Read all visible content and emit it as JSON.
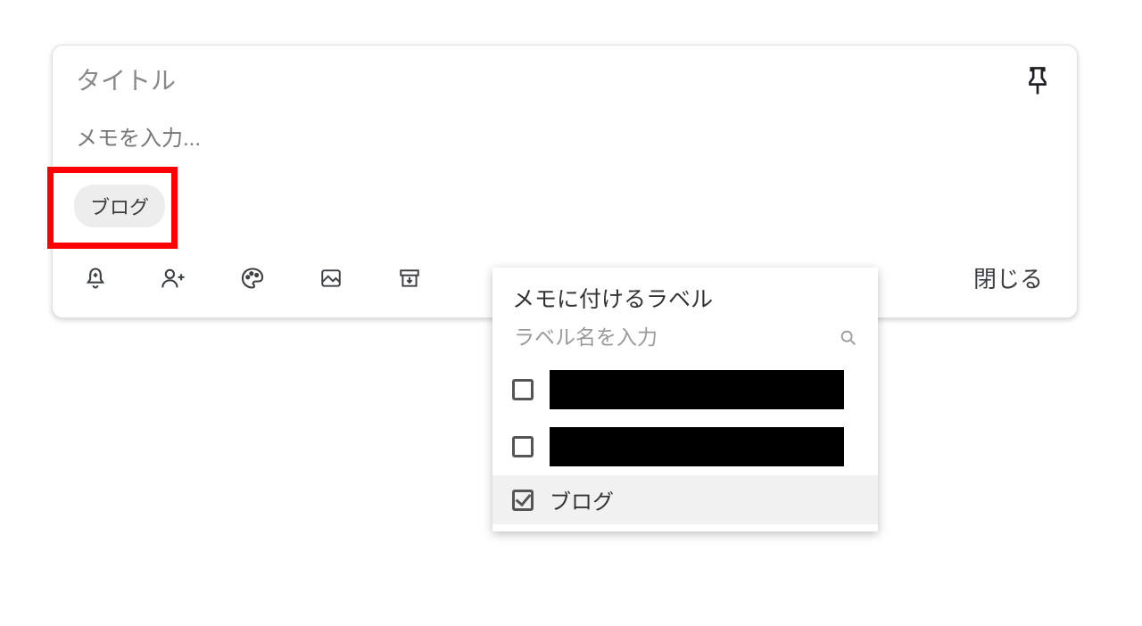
{
  "note": {
    "title_placeholder": "タイトル",
    "body_placeholder": "メモを入力...",
    "chip_label": "ブログ",
    "close_label": "閉じる"
  },
  "popup": {
    "title": "メモに付けるラベル",
    "search_placeholder": "ラベル名を入力",
    "items": [
      {
        "label": "",
        "checked": false,
        "redacted": true
      },
      {
        "label": "",
        "checked": false,
        "redacted": true
      },
      {
        "label": "ブログ",
        "checked": true,
        "redacted": false
      }
    ]
  }
}
